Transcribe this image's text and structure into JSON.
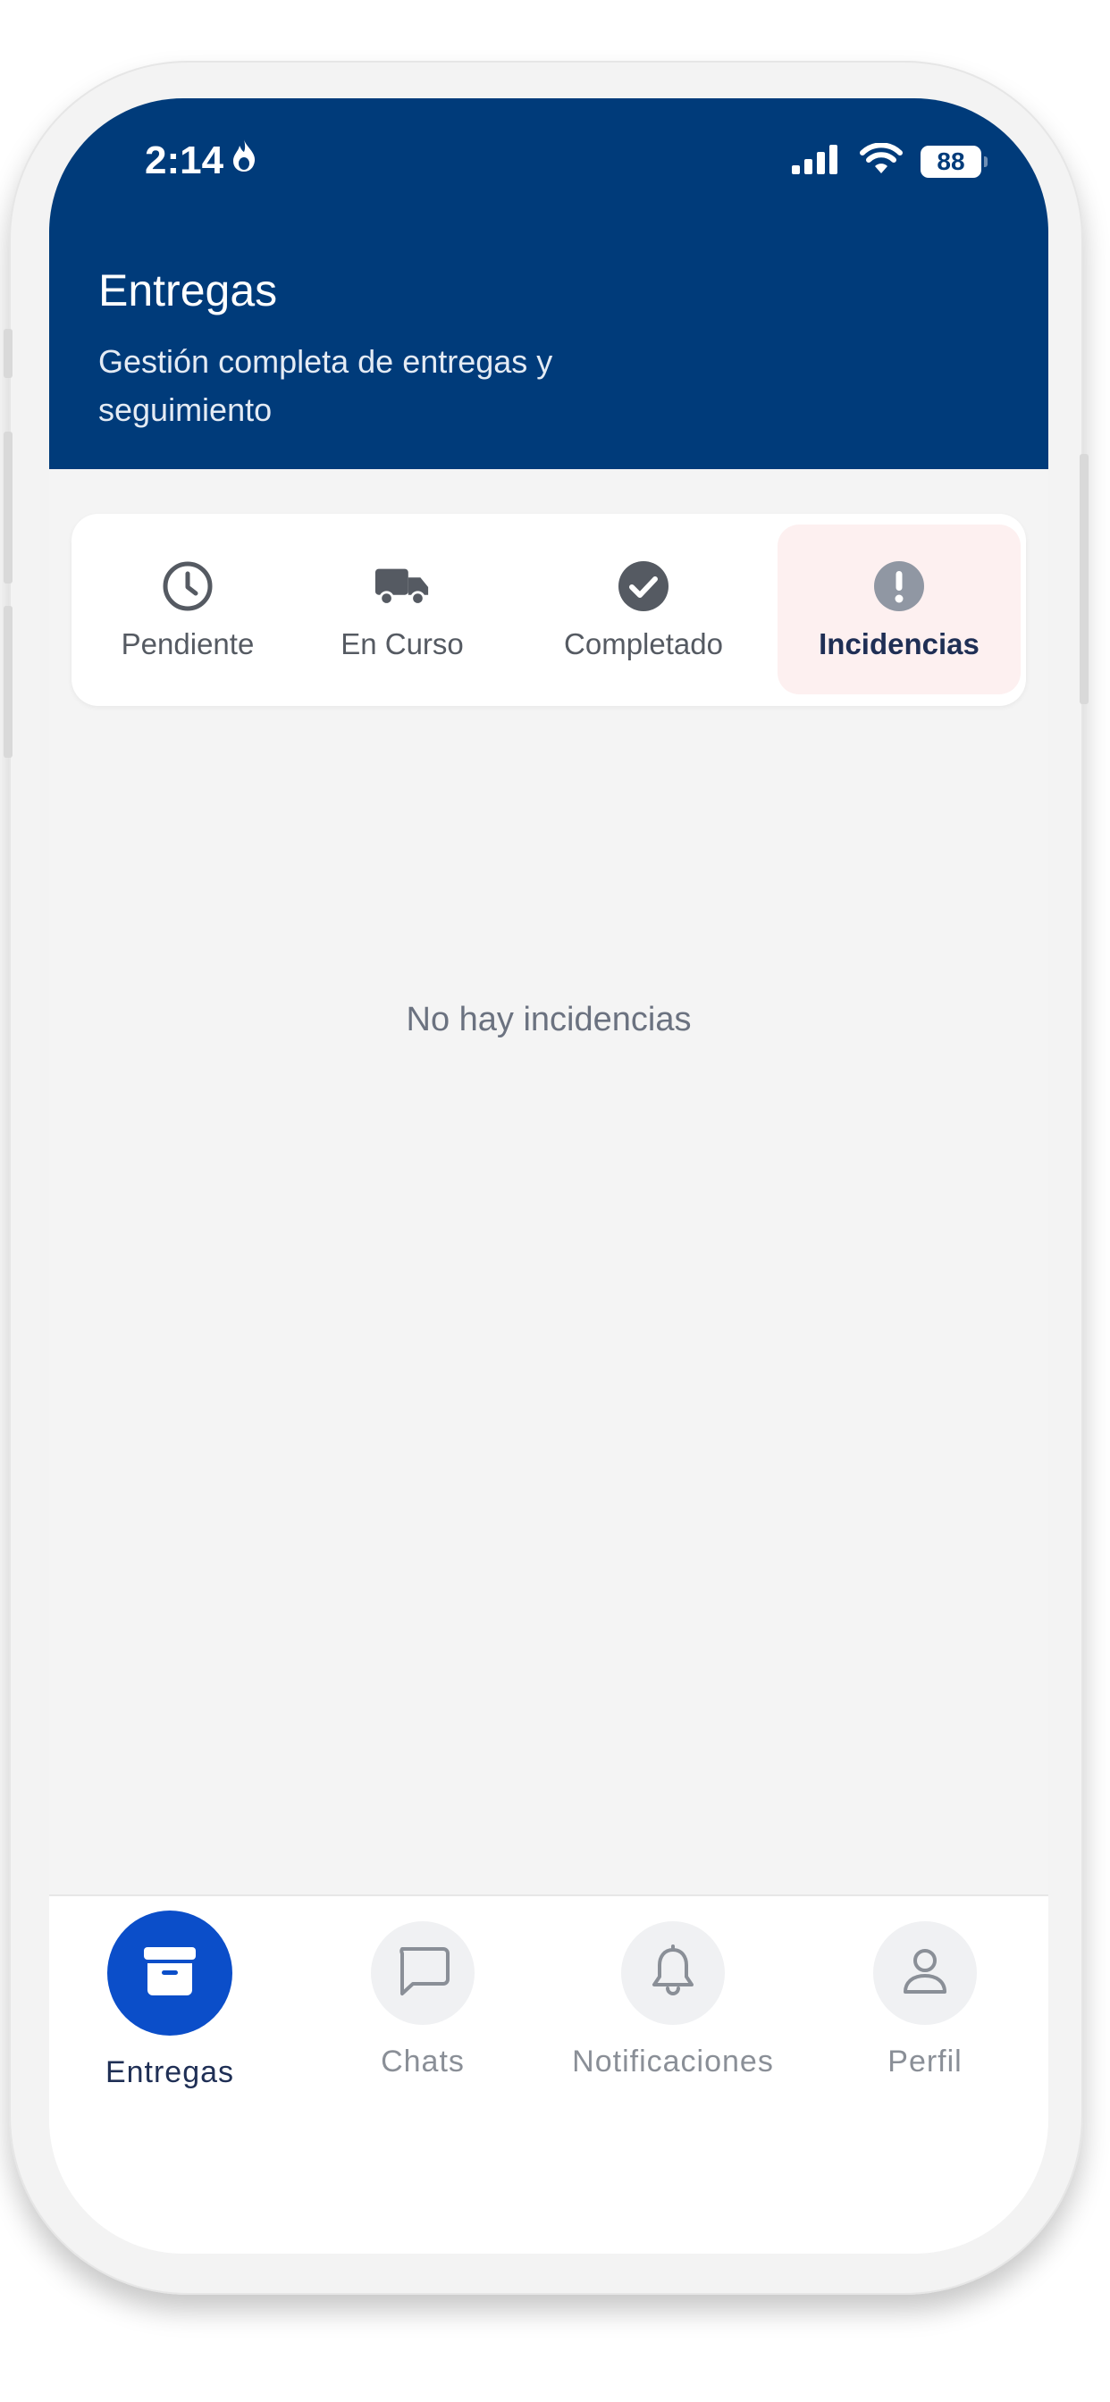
{
  "status_bar": {
    "time": "2:14",
    "battery": "88"
  },
  "header": {
    "title": "Entregas",
    "subtitle": "Gestión completa de entregas y seguimiento"
  },
  "tabs": [
    {
      "label": "Pendiente",
      "icon": "clock-icon",
      "active": false
    },
    {
      "label": "En Curso",
      "icon": "truck-icon",
      "active": false
    },
    {
      "label": "Completado",
      "icon": "check-circle-icon",
      "active": false
    },
    {
      "label": "Incidencias",
      "icon": "alert-circle-icon",
      "active": true
    }
  ],
  "main": {
    "empty_message": "No hay incidencias"
  },
  "bottom_nav": [
    {
      "label": "Entregas",
      "icon": "archive-box-icon",
      "active": true
    },
    {
      "label": "Chats",
      "icon": "chat-bubble-icon",
      "active": false
    },
    {
      "label": "Notificaciones",
      "icon": "bell-icon",
      "active": false
    },
    {
      "label": "Perfil",
      "icon": "user-icon",
      "active": false
    }
  ],
  "colors": {
    "header_bg": "#003b7a",
    "active_nav": "#0b4ec9",
    "active_tab_bg": "#fdf0f0"
  }
}
